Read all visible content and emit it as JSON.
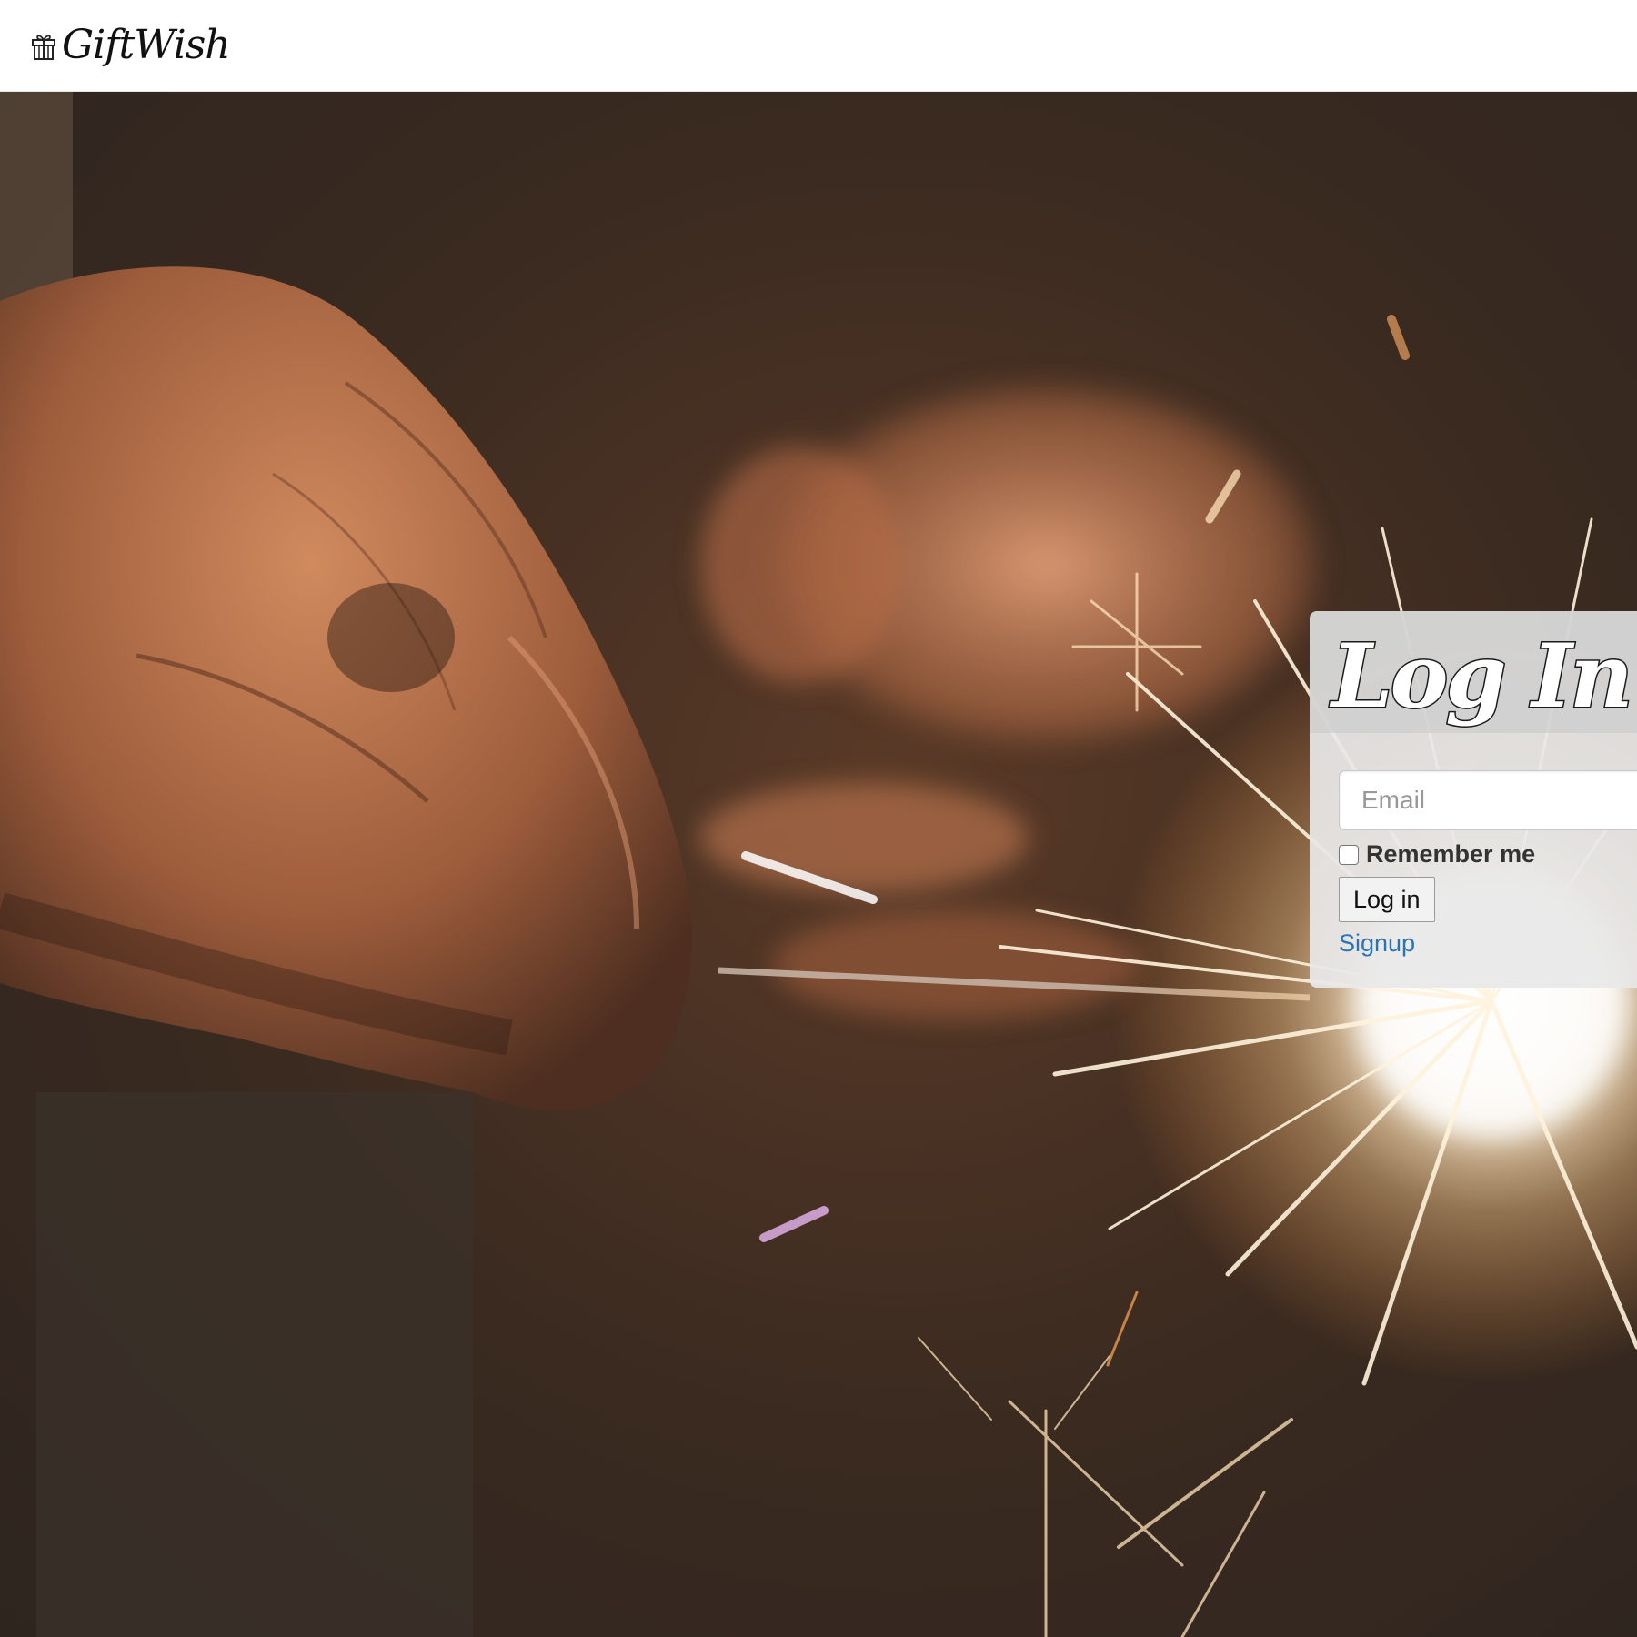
{
  "navbar": {
    "brand_name": "GiftWish",
    "brand_icon": "gift-icon"
  },
  "hero": {
    "background": "photo-hands-holding-sparkler"
  },
  "login": {
    "title": "Log In",
    "email_placeholder": "Email",
    "email_value": "",
    "remember_label": "Remember me",
    "remember_checked": false,
    "submit_label": "Log in",
    "signup_label": "Signup"
  },
  "colors": {
    "link": "#2a73b8",
    "panel_bg": "#e8e8e8",
    "navbar_bg": "#ffffff"
  }
}
